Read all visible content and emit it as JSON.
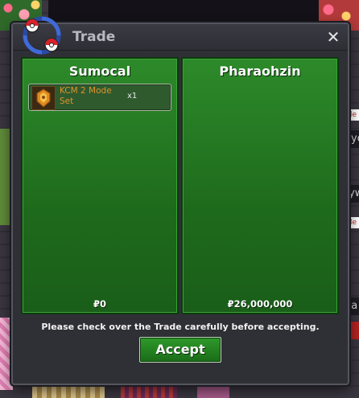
{
  "window": {
    "title": "Trade",
    "close_label": "✕",
    "icon": "trade-swap-icon"
  },
  "panels": [
    {
      "player": "Sumocal",
      "items": [
        {
          "name": "KCM 2 Mode Set",
          "quantity": "x1",
          "icon": "kcm-item-icon"
        }
      ],
      "money": "₽0"
    },
    {
      "player": "Pharaohzin",
      "items": [],
      "money": "₽26,000,000"
    }
  ],
  "notice": "Please check over the Trade carefully before accepting.",
  "accept_label": "Accept",
  "chat_strip": {
    "lines": [
      "ttle",
      "eyo",
      "tyw",
      "ttle",
      "ga"
    ]
  },
  "colors": {
    "panel_green": "#1e6a1c",
    "item_name": "#e0932a",
    "window_bg": "#2f2f36"
  }
}
